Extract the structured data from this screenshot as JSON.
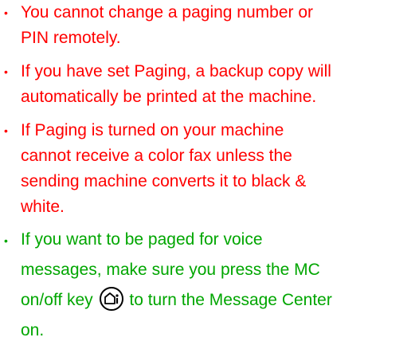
{
  "notes": [
    {
      "bullet": "•",
      "color": "#ff0000",
      "lines": [
        "You cannot change a paging number or",
        "PIN remotely."
      ]
    },
    {
      "bullet": "•",
      "color": "#ff0000",
      "lines": [
        "If you have set Paging, a backup copy will",
        "automatically be printed at the machine."
      ]
    },
    {
      "bullet": "•",
      "color": "#ff0000",
      "lines": [
        "If Paging is turned on your machine",
        "cannot receive a color fax unless the",
        "sending machine converts it to black &",
        "white."
      ]
    },
    {
      "bullet": "•",
      "color": "#00a600",
      "lines": [
        "If you want to be paged for voice",
        "messages, make sure you press the MC",
        "on/off key",
        "to turn the Message Center",
        "on."
      ],
      "icon": "mc-on-off-key-icon"
    }
  ]
}
